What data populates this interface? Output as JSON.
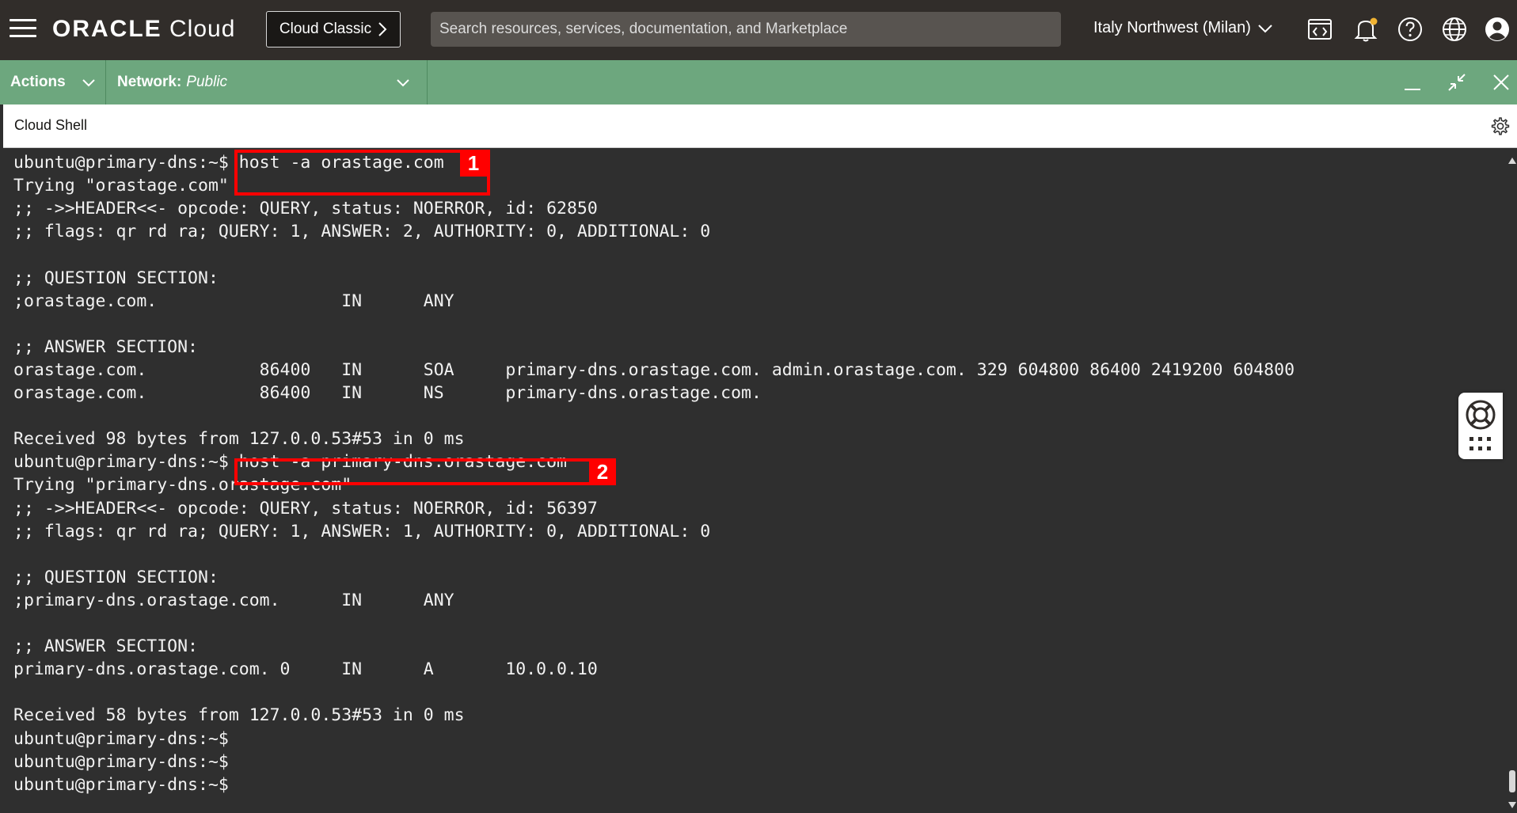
{
  "topbar": {
    "brand_bold": "ORACLE",
    "brand_light": "Cloud",
    "classic_label": "Cloud Classic",
    "search_placeholder": "Search resources, services, documentation, and Marketplace",
    "region": "Italy Northwest (Milan)"
  },
  "shell": {
    "actions_label": "Actions",
    "network_label": "Network:",
    "network_value": "Public",
    "title": "Cloud Shell"
  },
  "terminal": {
    "lines": [
      "ubuntu@primary-dns:~$ host -a orastage.com",
      "Trying \"orastage.com\"",
      ";; ->>HEADER<<- opcode: QUERY, status: NOERROR, id: 62850",
      ";; flags: qr rd ra; QUERY: 1, ANSWER: 2, AUTHORITY: 0, ADDITIONAL: 0",
      "",
      ";; QUESTION SECTION:",
      ";orastage.com.                  IN      ANY",
      "",
      ";; ANSWER SECTION:",
      "orastage.com.           86400   IN      SOA     primary-dns.orastage.com. admin.orastage.com. 329 604800 86400 2419200 604800",
      "orastage.com.           86400   IN      NS      primary-dns.orastage.com.",
      "",
      "Received 98 bytes from 127.0.0.53#53 in 0 ms",
      "ubuntu@primary-dns:~$ host -a primary-dns.orastage.com",
      "Trying \"primary-dns.orastage.com\"",
      ";; ->>HEADER<<- opcode: QUERY, status: NOERROR, id: 56397",
      ";; flags: qr rd ra; QUERY: 1, ANSWER: 1, AUTHORITY: 0, ADDITIONAL: 0",
      "",
      ";; QUESTION SECTION:",
      ";primary-dns.orastage.com.      IN      ANY",
      "",
      ";; ANSWER SECTION:",
      "primary-dns.orastage.com. 0     IN      A       10.0.0.10",
      "",
      "Received 58 bytes from 127.0.0.53#53 in 0 ms",
      "ubuntu@primary-dns:~$",
      "ubuntu@primary-dns:~$",
      "ubuntu@primary-dns:~$"
    ]
  },
  "annotations": [
    {
      "number": "1"
    },
    {
      "number": "2"
    }
  ],
  "colors": {
    "topbar": "#312d2a",
    "shellbar": "#6da77e",
    "terminal_bg": "#2f2f2f",
    "highlight": "#ff0000"
  }
}
